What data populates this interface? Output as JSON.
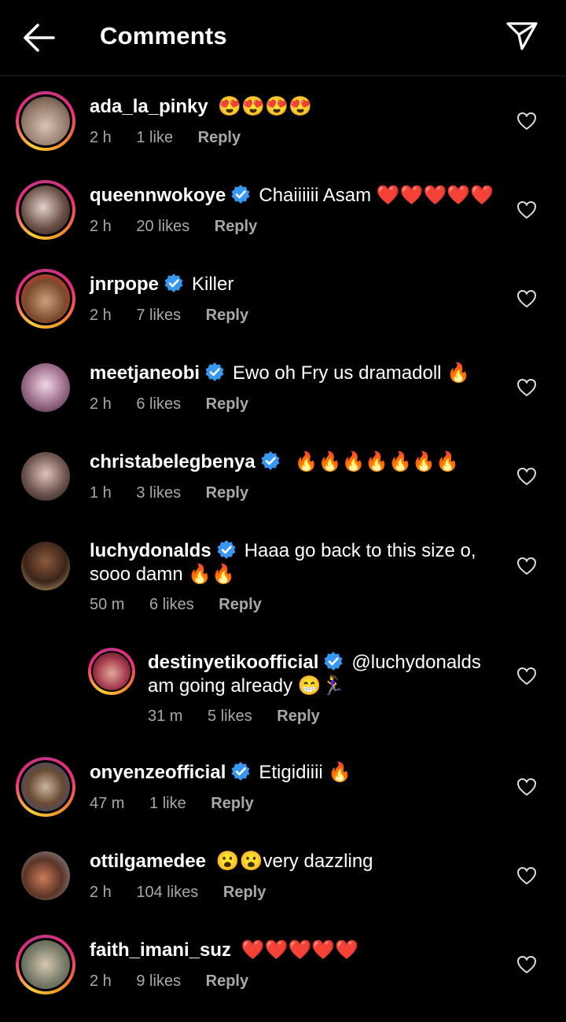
{
  "header": {
    "title": "Comments"
  },
  "comments": [
    {
      "username": "ada_la_pinky",
      "verified": false,
      "text": "😍😍😍😍",
      "time": "2 h",
      "likes": "1 like",
      "reply": "Reply"
    },
    {
      "username": "queennwokoye",
      "verified": true,
      "text": "Chaiiiiii Asam ❤️❤️❤️❤️❤️",
      "time": "2 h",
      "likes": "20 likes",
      "reply": "Reply"
    },
    {
      "username": "jnrpope",
      "verified": true,
      "text": "Killer",
      "time": "2 h",
      "likes": "7 likes",
      "reply": "Reply"
    },
    {
      "username": "meetjaneobi",
      "verified": true,
      "text": "Ewo oh Fry us dramadoll 🔥",
      "time": "2 h",
      "likes": "6 likes",
      "reply": "Reply"
    },
    {
      "username": "christabelegbenya",
      "verified": true,
      "text": "🔥🔥🔥🔥🔥🔥🔥",
      "time": "1 h",
      "likes": "3 likes",
      "reply": "Reply"
    },
    {
      "username": "luchydonalds",
      "verified": true,
      "text": "Haaa go back to this size o,",
      "text2": "sooo damn 🔥🔥",
      "time": "50 m",
      "likes": "6 likes",
      "reply": "Reply"
    },
    {
      "username": "destinyetikoofficial",
      "verified": true,
      "text": "@luchydonalds",
      "text2": "am going already 😁🏃‍♀️",
      "time": "31 m",
      "likes": "5 likes",
      "reply": "Reply"
    },
    {
      "username": "onyenzeofficial",
      "verified": true,
      "text": "Etigidiiii 🔥",
      "time": "47 m",
      "likes": "1 like",
      "reply": "Reply"
    },
    {
      "username": "ottilgamedee",
      "verified": false,
      "text": "😮😮very dazzling",
      "time": "2 h",
      "likes": "104 likes",
      "reply": "Reply"
    },
    {
      "username": "faith_imani_suz",
      "verified": false,
      "text": "❤️❤️❤️❤️❤️",
      "time": "2 h",
      "likes": "9 likes",
      "reply": "Reply"
    }
  ],
  "icons": {
    "back": "back-arrow-icon",
    "share": "paper-plane-icon",
    "verified": "verified-badge-icon",
    "like": "heart-outline-icon"
  },
  "colors": {
    "background": "#000000",
    "meta_text": "#a8a8a8",
    "verified": "#3897f0"
  }
}
